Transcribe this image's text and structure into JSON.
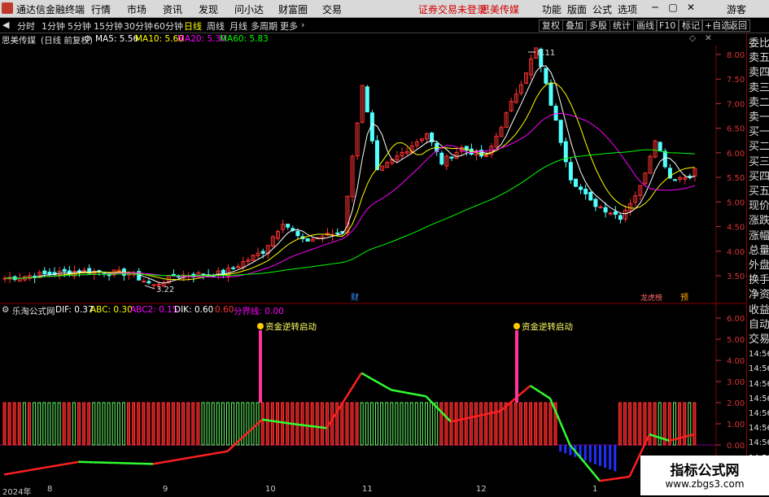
{
  "app": {
    "title": "通达信金融终端",
    "notice": "证券交易未登录",
    "stock": "思美传媒"
  },
  "menu": [
    "行情",
    "市场",
    "资讯",
    "发现",
    "问小达",
    "财富圈",
    "交易"
  ],
  "window_buttons": [
    "功能",
    "版面",
    "公式",
    "选项",
    "画线",
    "标记",
    "+自选",
    "返回",
    "游客"
  ],
  "periods": [
    "分时",
    "1分钟",
    "5分钟",
    "15分钟",
    "30分钟",
    "60分钟",
    "日线",
    "周线",
    "月线",
    "多周期",
    "更多"
  ],
  "active_period": "日线",
  "toolbar": [
    "复权",
    "叠加",
    "多股",
    "统计",
    "画线",
    "F10"
  ],
  "main_chart": {
    "stock_name": "思美传媒",
    "period_label": "(日线 前复权)",
    "ma": [
      {
        "label": "MA5: 5.56",
        "color": "#ffffff"
      },
      {
        "label": "MA10: 5.60",
        "color": "#ffff00"
      },
      {
        "label": "MA20: 5.30",
        "color": "#ff00ff"
      },
      {
        "label": "MA60: 5.83",
        "color": "#00ff00"
      }
    ],
    "y_ticks": [
      "8.00",
      "7.50",
      "7.00",
      "6.50",
      "6.00",
      "5.50",
      "5.00",
      "4.50",
      "4.00",
      "3.50"
    ],
    "high_label": "8.11",
    "low_label": "3.22",
    "markers": [
      "财",
      "龙虎榜",
      "预"
    ]
  },
  "indicator": {
    "name": "乐淘公式网",
    "values": [
      {
        "label": "DIF: 0.37",
        "color": "#ffffff"
      },
      {
        "label": "ABC: 0.30",
        "color": "#ffff00"
      },
      {
        "label": "ABC2: 0.15",
        "color": "#ff00ff"
      },
      {
        "label": "DIK: 0.60",
        "color": "#ffffff"
      },
      {
        "label": "0.60",
        "color": "#ff3333"
      },
      {
        "label": "分界线: 0.00",
        "color": "#ff00ff"
      }
    ],
    "y_ticks": [
      "6.00",
      "5.00",
      "4.00",
      "3.00",
      "2.00",
      "1.00",
      "0.00"
    ],
    "signal_label": "资金逆转启动"
  },
  "right_panel": [
    "委比",
    "卖五",
    "卖四",
    "卖三",
    "卖二",
    "卖一",
    "买一",
    "买二",
    "买三",
    "买四",
    "买五",
    "现价",
    "涨跌",
    "涨幅",
    "总量",
    "外盘",
    "换手",
    "净资",
    "收益",
    "自动",
    "交易",
    "14:56",
    "14:56",
    "14:56",
    "14:56",
    "14:56",
    "14:56",
    "14:56",
    "14:56"
  ],
  "dates": [
    "2024年",
    "8",
    "9",
    "10",
    "11",
    "12",
    "1"
  ],
  "watermark": {
    "title": "指标公式网",
    "url": "www.zbgs3.com"
  }
}
